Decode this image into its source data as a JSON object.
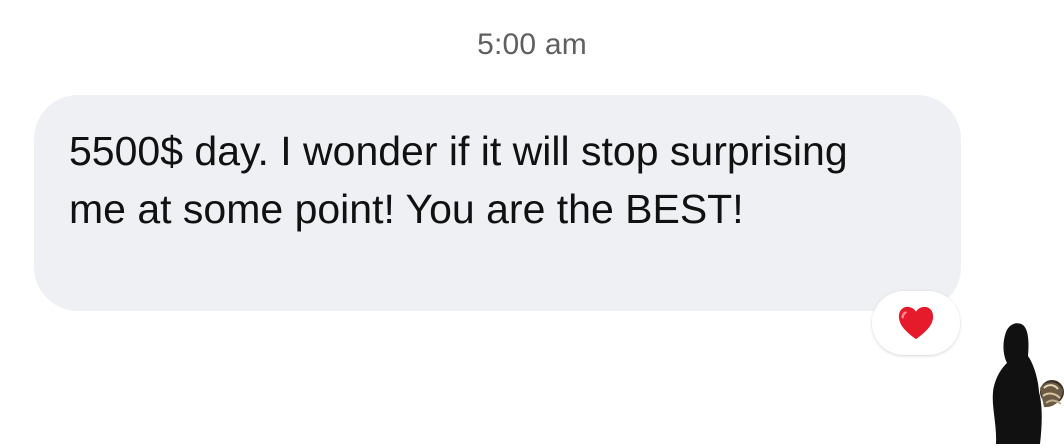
{
  "timestamp": "5:00 am",
  "message": {
    "text": "5500$ day. I wonder if it will stop surprising me at some point! You are the BEST!"
  },
  "reaction": {
    "icon": "heart-icon",
    "color": "#e51a2b"
  },
  "avatar": {
    "icon": "profile-silhouette-icon"
  },
  "colors": {
    "background": "#ffffff",
    "bubble": "#eff0f4",
    "text": "#111111",
    "timestamp": "#5f5f5f"
  }
}
